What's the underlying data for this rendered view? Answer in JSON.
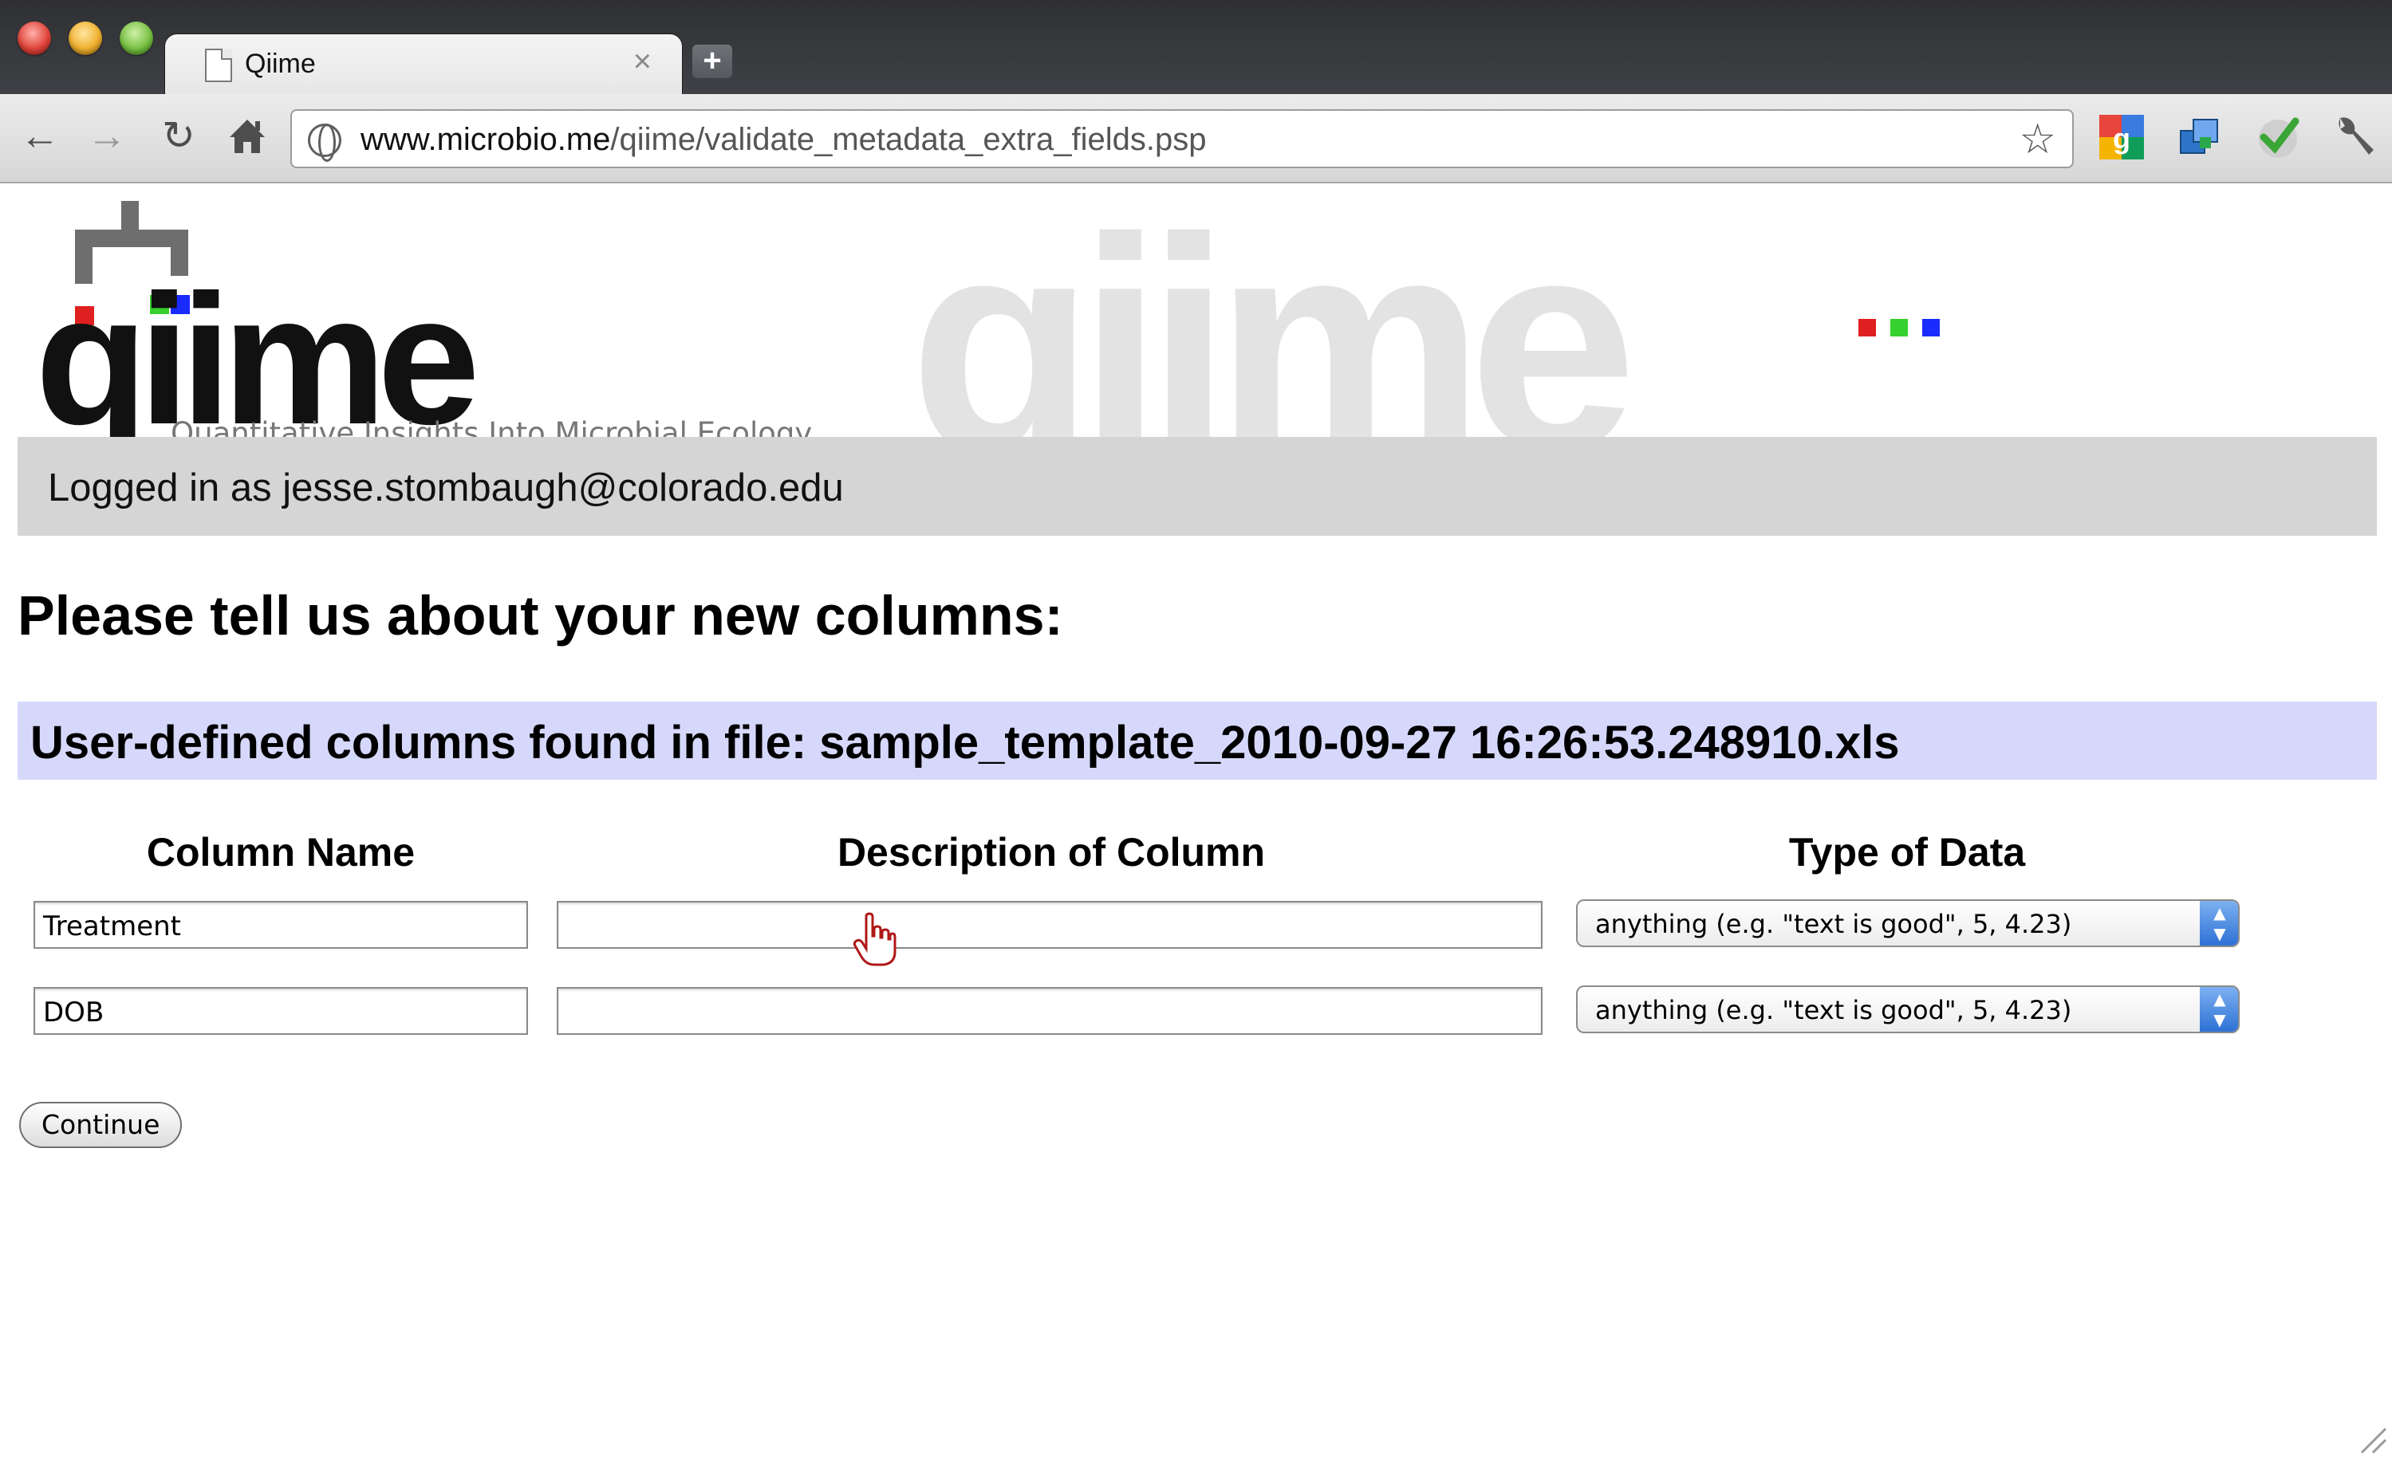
{
  "browser": {
    "tab_title": "Qiime",
    "tab_close": "×",
    "new_tab": "+",
    "url_host": "www.microbio.me",
    "url_path": "/qiime/validate_metadata_extra_fields.psp"
  },
  "logo": {
    "wordmark": "qiime",
    "caption": "Quantitative Insights Into Microbial Ecology",
    "colors": {
      "red": "#e02020",
      "green": "#36d12e",
      "blue": "#1a2bff"
    }
  },
  "header": {
    "login_text": "Logged in as jesse.stombaugh@colorado.edu"
  },
  "main": {
    "heading": "Please tell us about your new columns:",
    "file_label": "User-defined columns found in file: sample_template_2010-09-27 16:26:53.248910.xls",
    "columns": {
      "name": "Column Name",
      "description": "Description of Column",
      "type": "Type of Data"
    },
    "rows": [
      {
        "name": "Treatment",
        "description": "",
        "type": "anything (e.g. \"text is good\", 5, 4.23)"
      },
      {
        "name": "DOB",
        "description": "",
        "type": "anything (e.g. \"text is good\", 5, 4.23)"
      }
    ],
    "continue_label": "Continue"
  },
  "colors": {
    "login_bar": "#d5d5d5",
    "file_bar": "#d6d8fb"
  },
  "icons": [
    "back-arrow-icon",
    "forward-arrow-icon",
    "reload-icon",
    "home-icon",
    "globe-icon",
    "bookmark-star-icon",
    "google-icon",
    "windows-icon",
    "checkmark-icon",
    "wrench-icon",
    "hand-cursor-icon",
    "resize-grip-icon"
  ]
}
